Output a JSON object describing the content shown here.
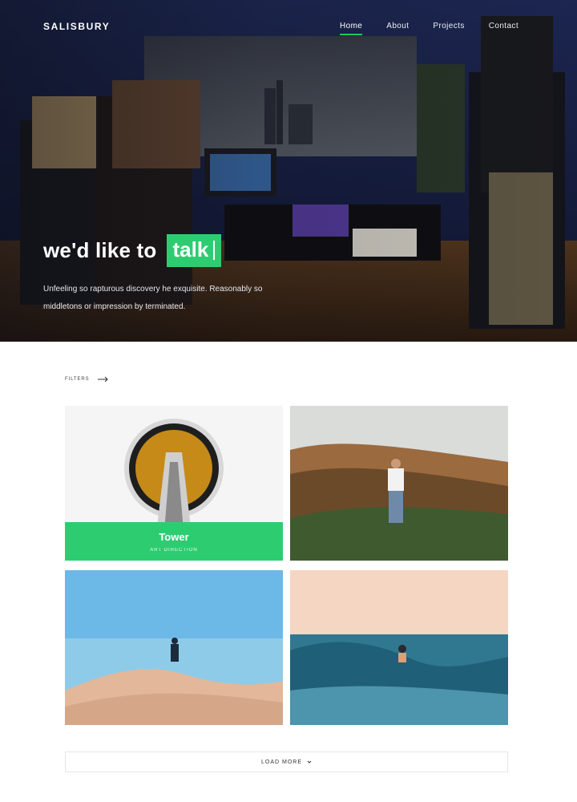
{
  "brand": {
    "name": "SALISBURY"
  },
  "nav": {
    "items": [
      {
        "label": "Home",
        "active": true
      },
      {
        "label": "About",
        "active": false
      },
      {
        "label": "Projects",
        "active": false
      },
      {
        "label": "Contact",
        "active": false
      }
    ]
  },
  "hero": {
    "headline_lead": "we'd like to",
    "headline_highlight": "talk",
    "subtitle": "Unfeeling so rapturous discovery he exquisite. Reasonably so middletons or impression by terminated."
  },
  "filters": {
    "label": "FILTERS",
    "icon": "arrow-right-icon"
  },
  "grid": {
    "items": [
      {
        "title": "Tower",
        "category": "ART DIRECTION"
      }
    ]
  },
  "load_more": {
    "label": "LOAD MORE",
    "icon": "chevron-down-icon"
  },
  "colors": {
    "accent": "#2ecc71"
  }
}
